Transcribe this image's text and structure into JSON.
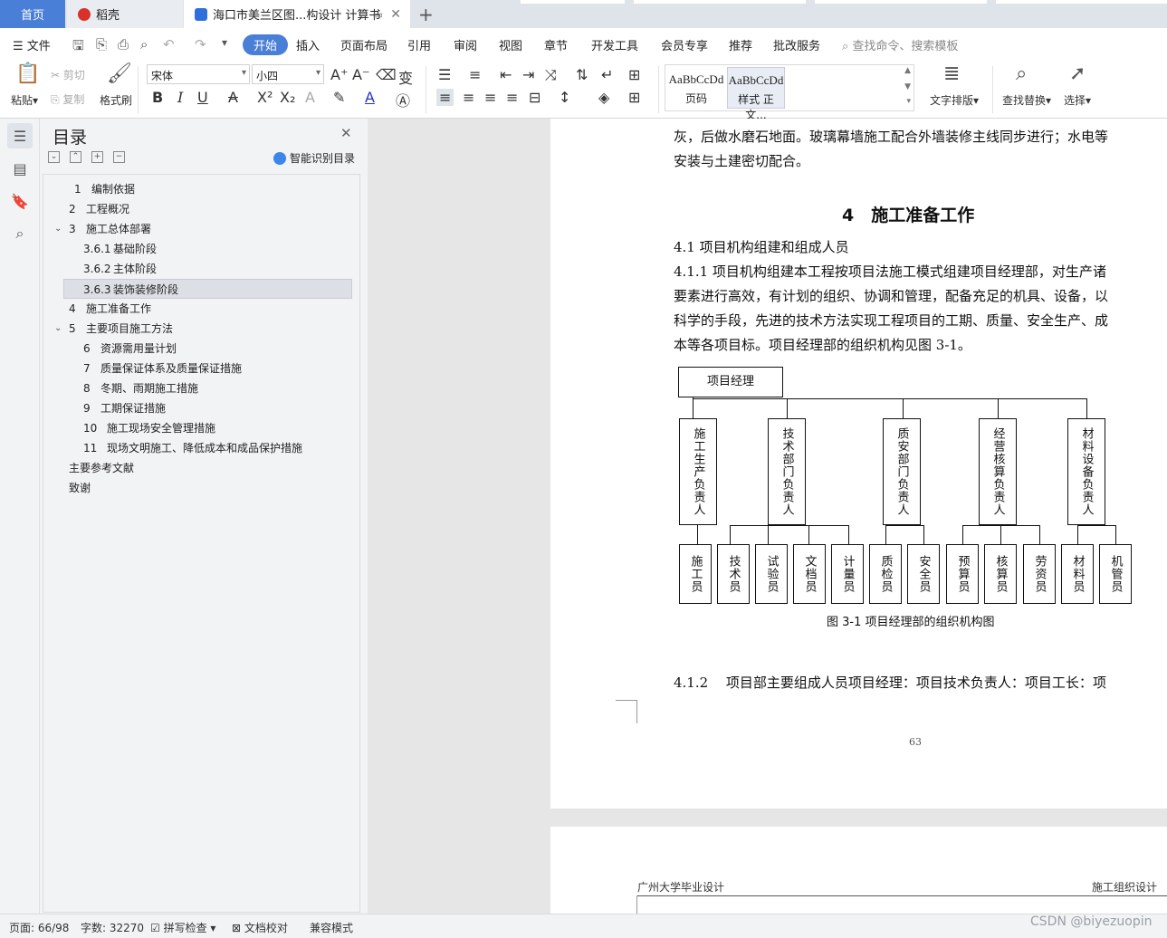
{
  "tabs": {
    "home": "首页",
    "daoke": "稻壳",
    "doc": "海口市美兰区图...构设计 计算书",
    "new_tab": "+"
  },
  "menu": {
    "file": "文件",
    "items": [
      "开始",
      "插入",
      "页面布局",
      "引用",
      "审阅",
      "视图",
      "章节",
      "开发工具",
      "会员专享",
      "推荐",
      "批改服务"
    ],
    "search_placeholder": "查找命令、搜索模板"
  },
  "ribbon": {
    "paste": "粘贴",
    "cut": "剪切",
    "copy": "复制",
    "format_painter": "格式刷",
    "font_name": "宋体",
    "font_size": "小四",
    "style_1_preview": "AaBbCcDd",
    "style_1_label": "页码",
    "style_2_preview": "AaBbCcDd",
    "style_2_label": "样式 正文...",
    "text_layout": "文字排版",
    "find_replace": "查找替换",
    "select": "选择"
  },
  "toc": {
    "title": "目录",
    "ai_button": "智能识别目录",
    "items": [
      {
        "num": "1",
        "text": "编制依据",
        "level": 1
      },
      {
        "num": "2",
        "text": "工程概况",
        "level": 1
      },
      {
        "num": "3",
        "text": "施工总体部署",
        "level": 1,
        "expanded": true
      },
      {
        "num": "3.6.1",
        "text": "基础阶段",
        "level": 2
      },
      {
        "num": "3.6.2",
        "text": "主体阶段",
        "level": 2
      },
      {
        "num": "3.6.3",
        "text": "装饰装修阶段",
        "level": 2,
        "active": true
      },
      {
        "num": "4",
        "text": "施工准备工作",
        "level": 1
      },
      {
        "num": "5",
        "text": "主要项目施工方法",
        "level": 1,
        "expanded": true
      },
      {
        "num": "6",
        "text": "资源需用量计划",
        "level": 2
      },
      {
        "num": "7",
        "text": "质量保证体系及质量保证措施",
        "level": 2
      },
      {
        "num": "8",
        "text": "冬期、雨期施工措施",
        "level": 2
      },
      {
        "num": "9",
        "text": "工期保证措施",
        "level": 2
      },
      {
        "num": "10",
        "text": "施工现场安全管理措施",
        "level": 2
      },
      {
        "num": "11",
        "text": "现场文明施工、降低成本和成品保护措施",
        "level": 2
      },
      {
        "num": "",
        "text": "主要参考文献",
        "level": 0
      },
      {
        "num": "",
        "text": "致谢",
        "level": 0
      }
    ]
  },
  "document": {
    "para_top_1": "灰，后做水磨石地面。玻璃幕墙施工配合外墙装修主线同步进行；水电等",
    "para_top_2": "安装与土建密切配合。",
    "heading": "4　施工准备工作",
    "sub_41": "4.1 项目机构组建和组成人员",
    "para_411_1": "4.1.1 项目机构组建本工程按项目法施工模式组建项目经理部，对生产诸",
    "para_411_2": "要素进行高效，有计划的组织、协调和管理，配备充足的机具、设备，以",
    "para_411_3": "科学的手段，先进的技术方法实现工程项目的工期、质量、安全生产、成",
    "para_411_4": "本等各项目标。项目经理部的组织机构见图 3-1。",
    "org_top": "项目经理",
    "org_heads": [
      "施工生产负责人",
      "技术部门负责人",
      "质安部门负责人",
      "经营核算负责人",
      "材料设备负责人"
    ],
    "org_staff": [
      "施工员",
      "技术员",
      "试验员",
      "文档员",
      "计量员",
      "质检员",
      "安全员",
      "预算员",
      "核算员",
      "劳资员",
      "材料员",
      "机管员"
    ],
    "figure_caption": "图 3-1 项目经理部的组织机构图",
    "para_412": "4.1.2　 项目部主要组成人员项目经理：项目技术负责人：项目工长：项",
    "page_number": "63",
    "page2_header_left": "广州大学毕业设计",
    "page2_header_right": "施工组织设计"
  },
  "status": {
    "page": "页面: 66/98",
    "words": "字数: 32270",
    "spell": "拼写检查",
    "proof": "文档校对",
    "compat": "兼容模式"
  },
  "watermark": "CSDN @biyezuopin",
  "colors": {
    "accent": "#4a7fd8",
    "tab_bg": "#dfe3ea",
    "panel_bg": "#f2f3f5"
  }
}
